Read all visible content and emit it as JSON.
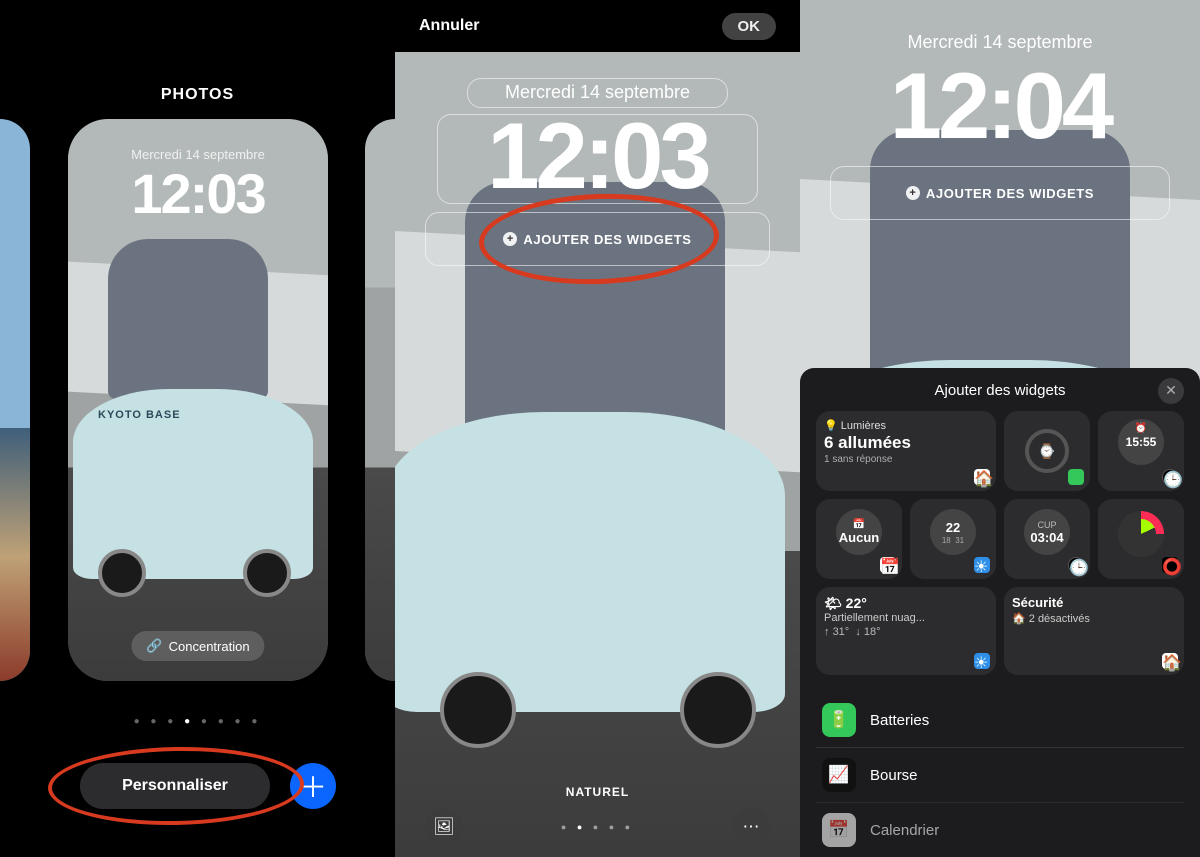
{
  "panel1": {
    "title": "PHOTOS",
    "date": "Mercredi 14 septembre",
    "time": "12:03",
    "focus": "Concentration",
    "personalise": "Personnaliser",
    "wallpaper_label": "KYOTO BASE"
  },
  "panel2": {
    "cancel": "Annuler",
    "ok": "OK",
    "date": "Mercredi 14 septembre",
    "time": "12:03",
    "add_widgets": "AJOUTER DES WIDGETS",
    "filter": "NATUREL"
  },
  "panel3": {
    "date": "Mercredi 14 septembre",
    "time": "12:04",
    "add_widgets": "AJOUTER DES WIDGETS",
    "sheet": {
      "title": "Ajouter des widgets",
      "lights": {
        "header": "Lumières",
        "main": "6 allumées",
        "sub": "1 sans réponse"
      },
      "alarm_time": "15:55",
      "calendar_none": "Aucun",
      "weather_ring": {
        "center": "22",
        "lo": "18",
        "hi": "31"
      },
      "world_clock": {
        "label": "CUP",
        "time": "03:04"
      },
      "weather": {
        "temp": "22°",
        "desc": "Partiellement nuag...",
        "hi": "31°",
        "lo": "18°"
      },
      "security": {
        "title": "Sécurité",
        "sub": "2 désactivés"
      },
      "apps": [
        {
          "name": "Batteries"
        },
        {
          "name": "Bourse"
        },
        {
          "name": "Calendrier"
        }
      ]
    }
  }
}
